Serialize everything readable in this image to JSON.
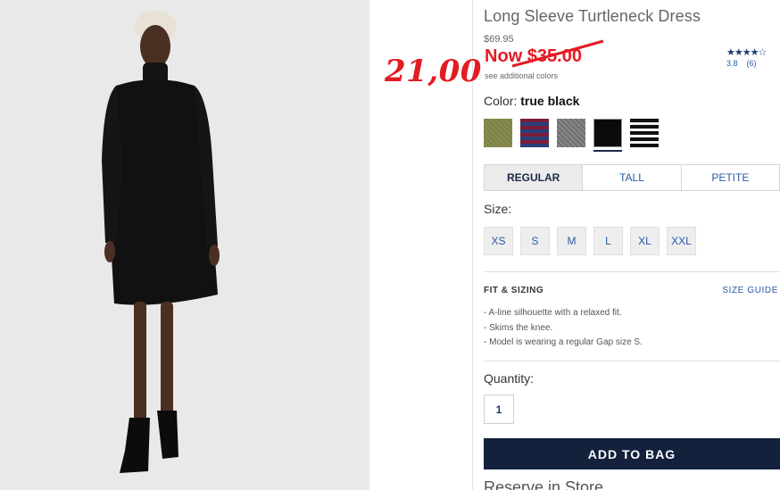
{
  "product": {
    "title": "Long Sleeve Turtleneck Dress",
    "original_price": "$69.95",
    "now_price": "Now $35.00",
    "see_colors": "see additional colors",
    "handwritten_price": "21,00"
  },
  "rating": {
    "stars": "★★★★☆",
    "score": "3.8",
    "count": "(6)"
  },
  "color": {
    "label": "Color:",
    "selected": "true black",
    "swatches": [
      "olive",
      "burgundy-navy-stripe",
      "heather-gray",
      "true-black",
      "black-white-stripe"
    ]
  },
  "fit_tabs": [
    "REGULAR",
    "TALL",
    "PETITE"
  ],
  "size": {
    "label": "Size:",
    "options": [
      "XS",
      "S",
      "M",
      "L",
      "XL",
      "XXL"
    ]
  },
  "fit_sizing": {
    "heading": "FIT & SIZING",
    "guide_link": "SIZE GUIDE",
    "bullets": [
      "- A-line silhouette with a relaxed fit.",
      "- Skims the knee.",
      "- Model is wearing a regular Gap size S."
    ]
  },
  "quantity": {
    "label": "Quantity:",
    "value": "1"
  },
  "add_to_bag": "ADD TO BAG",
  "reserve": "Reserve in Store",
  "colors": {
    "sale_red": "#e31b23",
    "navy": "#14213d",
    "link_blue": "#2b5aa5"
  }
}
